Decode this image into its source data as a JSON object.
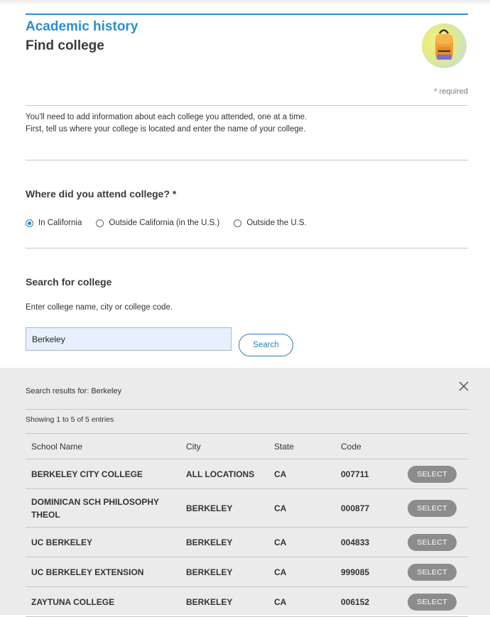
{
  "header": {
    "section": "Academic history",
    "title": "Find college",
    "icon": "backpack-icon"
  },
  "required_note": "* required",
  "intro": {
    "line1": "You'll need to add information about each college you attended, one at a time.",
    "line2": "First, tell us where your college is located and enter the name of your college."
  },
  "location_question": {
    "label": "Where did you attend college? *",
    "options": [
      {
        "label": "In California",
        "selected": true
      },
      {
        "label": "Outside California (in the U.S.)",
        "selected": false
      },
      {
        "label": "Outside the U.S.",
        "selected": false
      }
    ]
  },
  "search": {
    "heading": "Search for college",
    "help": "Enter college name, city or college code.",
    "value": "Berkeley",
    "button_label": "Search"
  },
  "results": {
    "for_label": "Search results for: Berkeley",
    "showing": "Showing 1 to 5 of 5 entries",
    "columns": [
      "School Name",
      "City",
      "State",
      "Code",
      ""
    ],
    "select_label": "SELECT",
    "rows": [
      {
        "name": "BERKELEY CITY COLLEGE",
        "city": "ALL LOCATIONS",
        "state": "CA",
        "code": "007711"
      },
      {
        "name": "DOMINICAN SCH PHILOSOPHY THEOL",
        "city": "BERKELEY",
        "state": "CA",
        "code": "000877"
      },
      {
        "name": "UC BERKELEY",
        "city": "BERKELEY",
        "state": "CA",
        "code": "004833"
      },
      {
        "name": "UC BERKELEY EXTENSION",
        "city": "BERKELEY",
        "state": "CA",
        "code": "999085"
      },
      {
        "name": "ZAYTUNA COLLEGE",
        "city": "BERKELEY",
        "state": "CA",
        "code": "006152"
      }
    ]
  },
  "colors": {
    "accent": "#2c8fce",
    "results_bg": "#ebebeb",
    "select_button": "#8c8c8c"
  }
}
